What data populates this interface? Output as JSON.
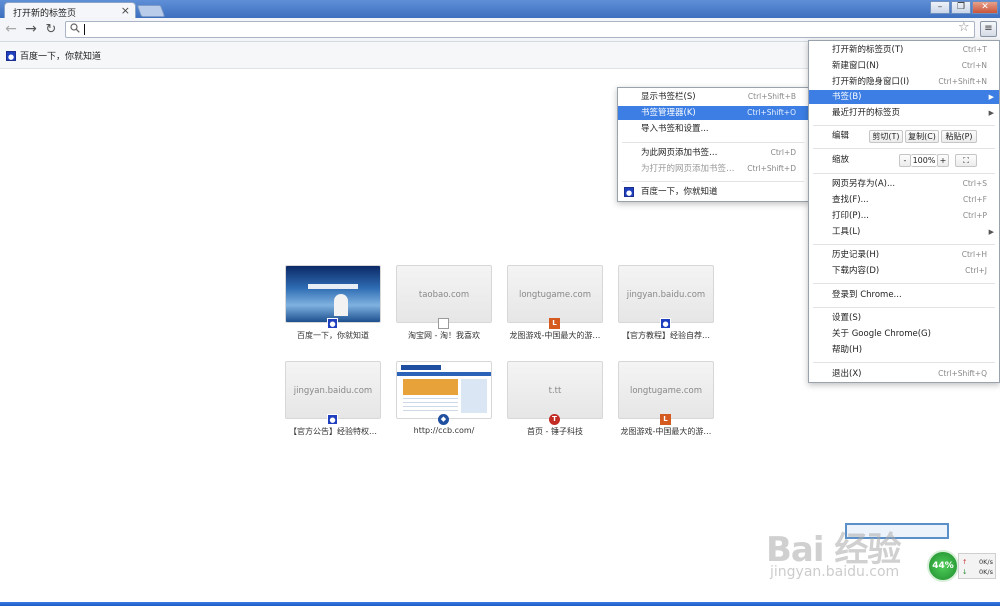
{
  "tab": {
    "title": "打开新的标签页",
    "close": "×"
  },
  "window": {
    "min": "–",
    "max": "❐",
    "close": "✕"
  },
  "toolbar": {
    "back_icon": "←",
    "forward_icon": "→",
    "reload_icon": "↻",
    "search_icon": "🔍",
    "star_icon": "☆",
    "menu_icon": "≡"
  },
  "bookmarks_bar": {
    "items": [
      {
        "label": "百度一下，你就知道",
        "icon": "baidu-paw-icon"
      }
    ]
  },
  "tiles": [
    {
      "thumb_text": "",
      "caption": "百度一下，你就知道",
      "favicon": "baidu-paw-icon"
    },
    {
      "thumb_text": "taobao.com",
      "caption": "淘宝网 - 淘！我喜欢",
      "favicon": "document-icon"
    },
    {
      "thumb_text": "longtugame.com",
      "caption": "龙图游戏-中国最大的游…",
      "favicon": "longtu-L-icon"
    },
    {
      "thumb_text": "jingyan.baidu.com",
      "caption": "【官方教程】经验自荐…",
      "favicon": "baidu-paw-icon"
    },
    {
      "thumb_text": "jingyan.baidu.com",
      "caption": "【官方公告】经验特权…",
      "favicon": "baidu-paw-icon"
    },
    {
      "thumb_text": "",
      "caption": "http://ccb.com/",
      "favicon": "ccb-icon"
    },
    {
      "thumb_text": "t.tt",
      "caption": "首页 - 锤子科技",
      "favicon": "smartisan-t-icon"
    },
    {
      "thumb_text": "longtugame.com",
      "caption": "龙图游戏-中国最大的游…",
      "favicon": "longtu-L-icon"
    }
  ],
  "main_menu": {
    "new_tab": {
      "label": "打开新的标签页(T)",
      "shortcut": "Ctrl+T"
    },
    "new_window": {
      "label": "新建窗口(N)",
      "shortcut": "Ctrl+N"
    },
    "incognito": {
      "label": "打开新的隐身窗口(I)",
      "shortcut": "Ctrl+Shift+N"
    },
    "bookmarks": {
      "label": "书签(B)",
      "arrow": "▶"
    },
    "recent_tabs": {
      "label": "最近打开的标签页",
      "arrow": "▶"
    },
    "edit": {
      "label": "编辑",
      "cut": "剪切(T)",
      "copy": "复制(C)",
      "paste": "粘贴(P)"
    },
    "zoom": {
      "label": "缩放",
      "minus": "-",
      "value": "100%",
      "plus": "+",
      "fullscreen": "⛶"
    },
    "save_as": {
      "label": "网页另存为(A)...",
      "shortcut": "Ctrl+S"
    },
    "find": {
      "label": "查找(F)...",
      "shortcut": "Ctrl+F"
    },
    "print": {
      "label": "打印(P)...",
      "shortcut": "Ctrl+P"
    },
    "tools": {
      "label": "工具(L)",
      "arrow": "▶"
    },
    "history": {
      "label": "历史记录(H)",
      "shortcut": "Ctrl+H"
    },
    "downloads": {
      "label": "下载内容(D)",
      "shortcut": "Ctrl+J"
    },
    "sign_in": {
      "label": "登录到 Chrome..."
    },
    "settings": {
      "label": "设置(S)"
    },
    "about": {
      "label": "关于 Google Chrome(G)"
    },
    "help": {
      "label": "帮助(H)"
    },
    "exit": {
      "label": "退出(X)",
      "shortcut": "Ctrl+Shift+Q"
    }
  },
  "bookmarks_submenu": {
    "show_bar": {
      "label": "显示书签栏(S)",
      "shortcut": "Ctrl+Shift+B"
    },
    "manager": {
      "label": "书签管理器(K)",
      "shortcut": "Ctrl+Shift+O"
    },
    "import": {
      "label": "导入书签和设置..."
    },
    "add_page": {
      "label": "为此网页添加书签…",
      "shortcut": "Ctrl+D"
    },
    "add_open": {
      "label": "为打开的网页添加书签…",
      "shortcut": "Ctrl+Shift+D"
    },
    "baidu": {
      "label": "百度一下，你就知道",
      "icon": "baidu-paw-icon"
    }
  },
  "watermark": {
    "logo": "Bai 经验",
    "url": "jingyan.baidu.com"
  },
  "speed_widget": {
    "percent": "44%",
    "up": "0K/s",
    "down": "0K/s",
    "up_icon": "↑",
    "down_icon": "↓"
  },
  "colors": {
    "highlight": "#3c7ee3",
    "titlebar": "#4a7cc9"
  }
}
